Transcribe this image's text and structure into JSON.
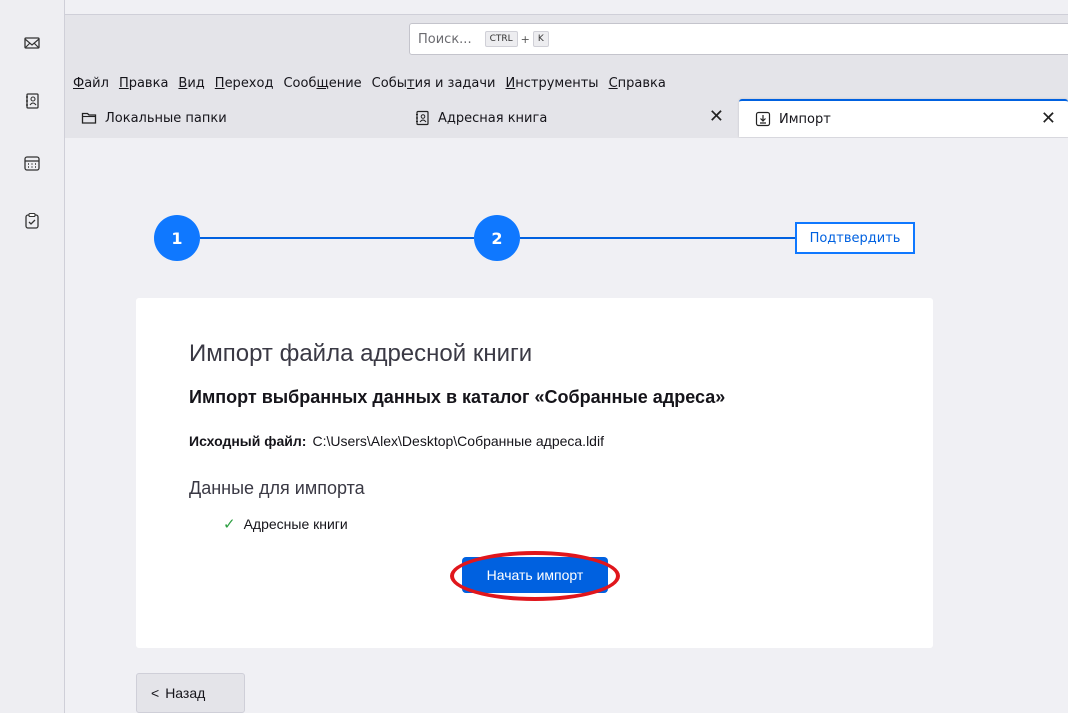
{
  "spaces": {
    "items": [
      {
        "name": "mail-icon"
      },
      {
        "name": "address-book-icon"
      },
      {
        "name": "calendar-icon"
      },
      {
        "name": "tasks-icon"
      }
    ]
  },
  "search": {
    "placeholder": "Поиск...",
    "shortcut_ctrl": "CTRL",
    "shortcut_plus": "+",
    "shortcut_key": "K"
  },
  "menubar": {
    "items": [
      {
        "u": "Ф",
        "rest": "айл"
      },
      {
        "u": "П",
        "rest": "равка"
      },
      {
        "u": "В",
        "rest": "ид"
      },
      {
        "u": "П",
        "rest": "ереход"
      },
      {
        "pre": "Сооб",
        "u": "щ",
        "rest": "ение"
      },
      {
        "pre": "Собы",
        "u": "т",
        "rest": "ия и задачи"
      },
      {
        "u": "И",
        "rest": "нструменты"
      },
      {
        "u": "С",
        "rest": "правка"
      }
    ]
  },
  "tabs": [
    {
      "label": "Локальные папки",
      "icon": "folder-icon"
    },
    {
      "label": "Адресная книга",
      "icon": "address-book-icon",
      "close": "✕"
    },
    {
      "label": "Импорт",
      "icon": "import-icon",
      "close": "✕"
    }
  ],
  "stepper": {
    "step1": "1",
    "step2": "2",
    "step3": "Подтвердить"
  },
  "card": {
    "title": "Импорт файла адресной книги",
    "subtitle": "Импорт выбранных данных в каталог «Собранные адреса»",
    "source_label": "Исходный файл:",
    "source_path": "C:\\Users\\Alex\\Desktop\\Собранные адреса.ldif",
    "data_heading": "Данные для импорта",
    "data_item": "Адресные книги",
    "start_button": "Начать импорт"
  },
  "back_button": "Назад",
  "colors": {
    "accent": "#0061e0",
    "step": "#0f78ff",
    "highlight": "#e0161c",
    "check": "#2ea043"
  }
}
